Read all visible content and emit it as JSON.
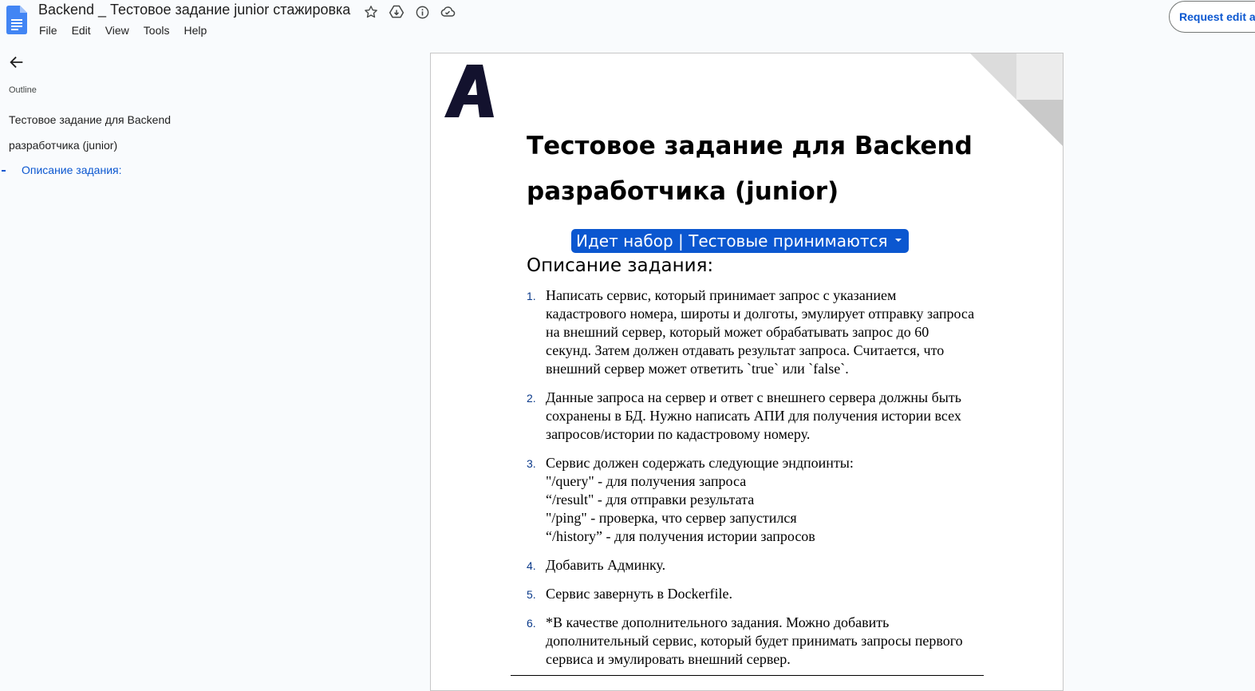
{
  "app": {
    "title": "Backend _ Тестовое задание junior стажировка",
    "menu": [
      "File",
      "Edit",
      "View",
      "Tools",
      "Help"
    ],
    "request_edit_label": "Request edit access",
    "title_icons": [
      "star-icon",
      "move-to-drive-icon",
      "info-icon",
      "cloud-status-icon"
    ]
  },
  "outline": {
    "label": "Outline",
    "items": [
      {
        "text": "Тестовое задание для Backend"
      },
      {
        "text": "разработчика (junior)"
      },
      {
        "text": "Описание задания:",
        "active": true
      }
    ]
  },
  "document": {
    "title_lines": [
      "Тестовое задание для Backend",
      "разработчика (junior)"
    ],
    "status_chip": "Идет набор | Тестовые принимаются",
    "section_heading": "Описание задания:",
    "tasks": [
      {
        "num": "1.",
        "lines": [
          "Написать сервис, который принимает запрос с указанием",
          "кадастрового номера, широты и долготы, эмулирует отправку запроса",
          "на внешний сервер, который может обрабатывать запрос до 60",
          "секунд. Затем должен отдавать результат запроса. Считается, что",
          "внешний сервер может ответить `true` или `false`."
        ]
      },
      {
        "num": "2.",
        "lines": [
          "Данные запроса на сервер и ответ с внешнего сервера должны быть",
          "сохранены в БД. Нужно написать АПИ для получения истории всех",
          "запросов/истории по кадастровому номеру."
        ]
      },
      {
        "num": "3.",
        "lines": [
          "Сервис должен содержать следующие эндпоинты:",
          "\"/query\" - для получения запроса",
          "“/result\" - для отправки результата",
          "\"/ping\" - проверка, что  сервер запустился",
          "“/history” - для получения истории запросов"
        ]
      },
      {
        "num": "4.",
        "lines": [
          "Добавить Админку."
        ]
      },
      {
        "num": "5.",
        "lines": [
          "Сервис завернуть в Dockerfile."
        ]
      },
      {
        "num": "6.",
        "lines": [
          "*В качестве дополнительного задания. Можно добавить",
          "дополнительный сервис, который будет принимать запросы первого",
          "сервиса и эмулировать внешний сервер."
        ]
      }
    ]
  },
  "colors": {
    "accent": "#0b57d0",
    "page_bg": "#f9fbfd"
  }
}
